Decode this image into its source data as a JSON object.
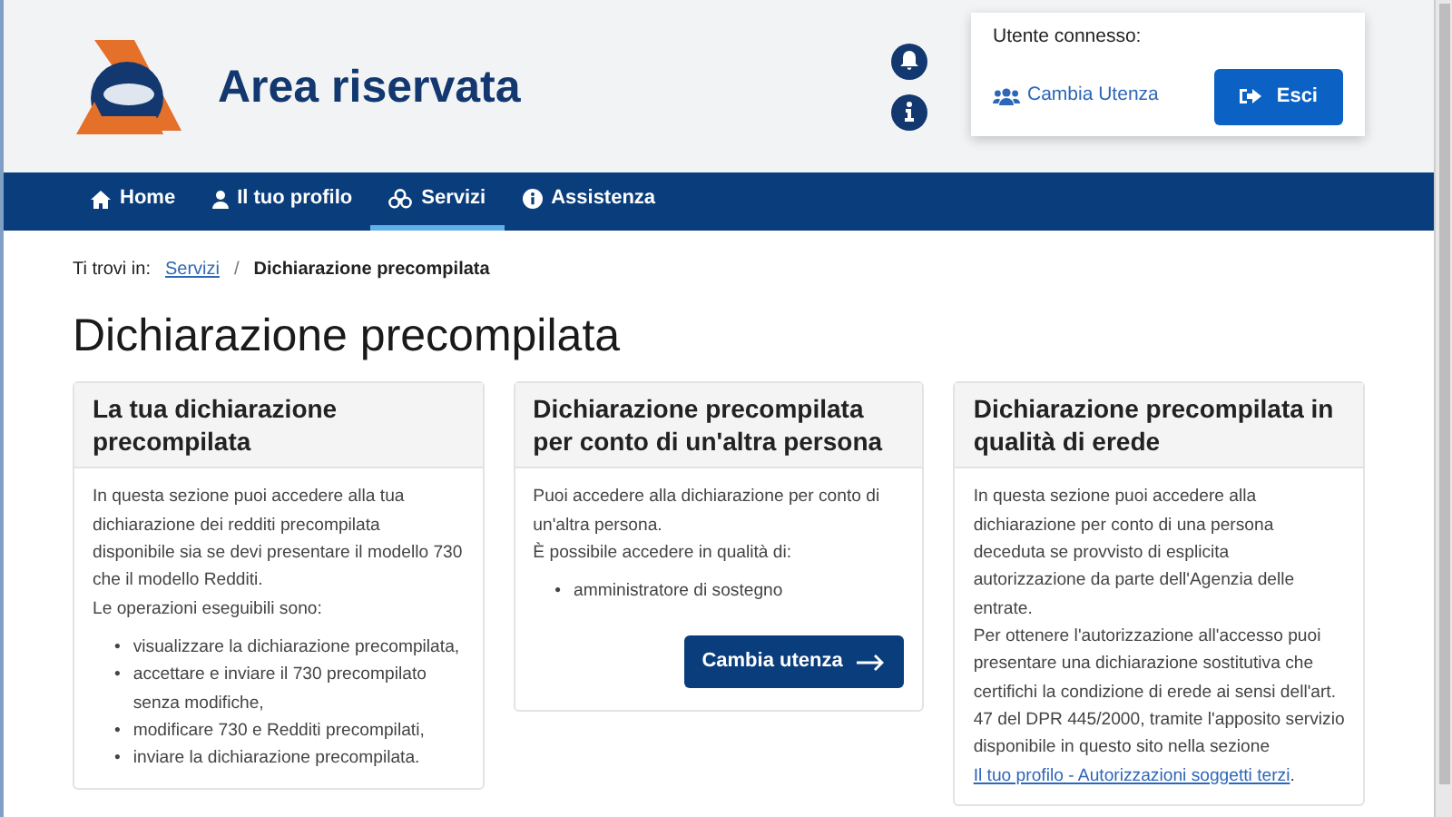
{
  "header": {
    "title": "Area riservata",
    "user_label": "Utente connesso:",
    "switch_user": "Cambia Utenza",
    "logout": "Esci"
  },
  "nav": [
    {
      "label": "Home",
      "selected": false
    },
    {
      "label": "Il tuo profilo",
      "selected": false
    },
    {
      "label": "Servizi",
      "selected": true
    },
    {
      "label": "Assistenza",
      "selected": false
    }
  ],
  "breadcrumb": {
    "prefix": "Ti trovi in:",
    "separator": "/",
    "items": [
      {
        "label": "Servizi",
        "kind": "link"
      },
      {
        "label": "Dichiarazione precompilata",
        "kind": "current"
      }
    ]
  },
  "page_title": "Dichiarazione precompilata",
  "cards": [
    {
      "title": "La tua dichiarazione precompilata",
      "paragraphs": [
        {
          "text": "In questa sezione puoi accedere alla tua dichiarazione dei redditi precompilata disponibile sia se devi presentare il modello 730 che il modello Redditi."
        },
        {
          "text": "Le operazioni eseguibili sono:"
        }
      ],
      "bullets": [
        {
          "marker": "•",
          "text": "visualizzare la dichiarazione precompilata,"
        },
        {
          "marker": "•",
          "text": "accettare e inviare il 730 precompilato senza modifiche,"
        },
        {
          "marker": "•",
          "text": "modificare 730 e Redditi precompilati,"
        },
        {
          "marker": "•",
          "text": "inviare la dichiarazione precompilata."
        }
      ]
    },
    {
      "title": "Dichiarazione precompilata per conto di un'altra persona",
      "paragraphs": [
        {
          "text": "Puoi accedere alla dichiarazione per conto di un'altra persona."
        },
        {
          "text": "È possibile accedere in qualità di:"
        }
      ],
      "bullets": [
        {
          "marker": "•",
          "text": "amministratore di sostegno"
        }
      ],
      "button": "Cambia utenza"
    },
    {
      "title": "Dichiarazione precompilata in qualità di erede",
      "paragraphs": [
        {
          "text": "In questa sezione puoi accedere alla dichiarazione per conto di una persona deceduta se provvisto di esplicita autorizzazione da parte dell'Agenzia delle entrate."
        },
        {
          "text": "Per ottenere l'autorizzazione all'accesso puoi presentare una dichiarazione sostitutiva che certifichi la condizione di erede ai sensi dell'art. 47 del DPR 445/2000, tramite l'apposito servizio disponibile in questo sito nella sezione",
          "link": "Il tuo profilo - Autorizzazioni soggetti terzi",
          "after": "."
        }
      ]
    }
  ]
}
